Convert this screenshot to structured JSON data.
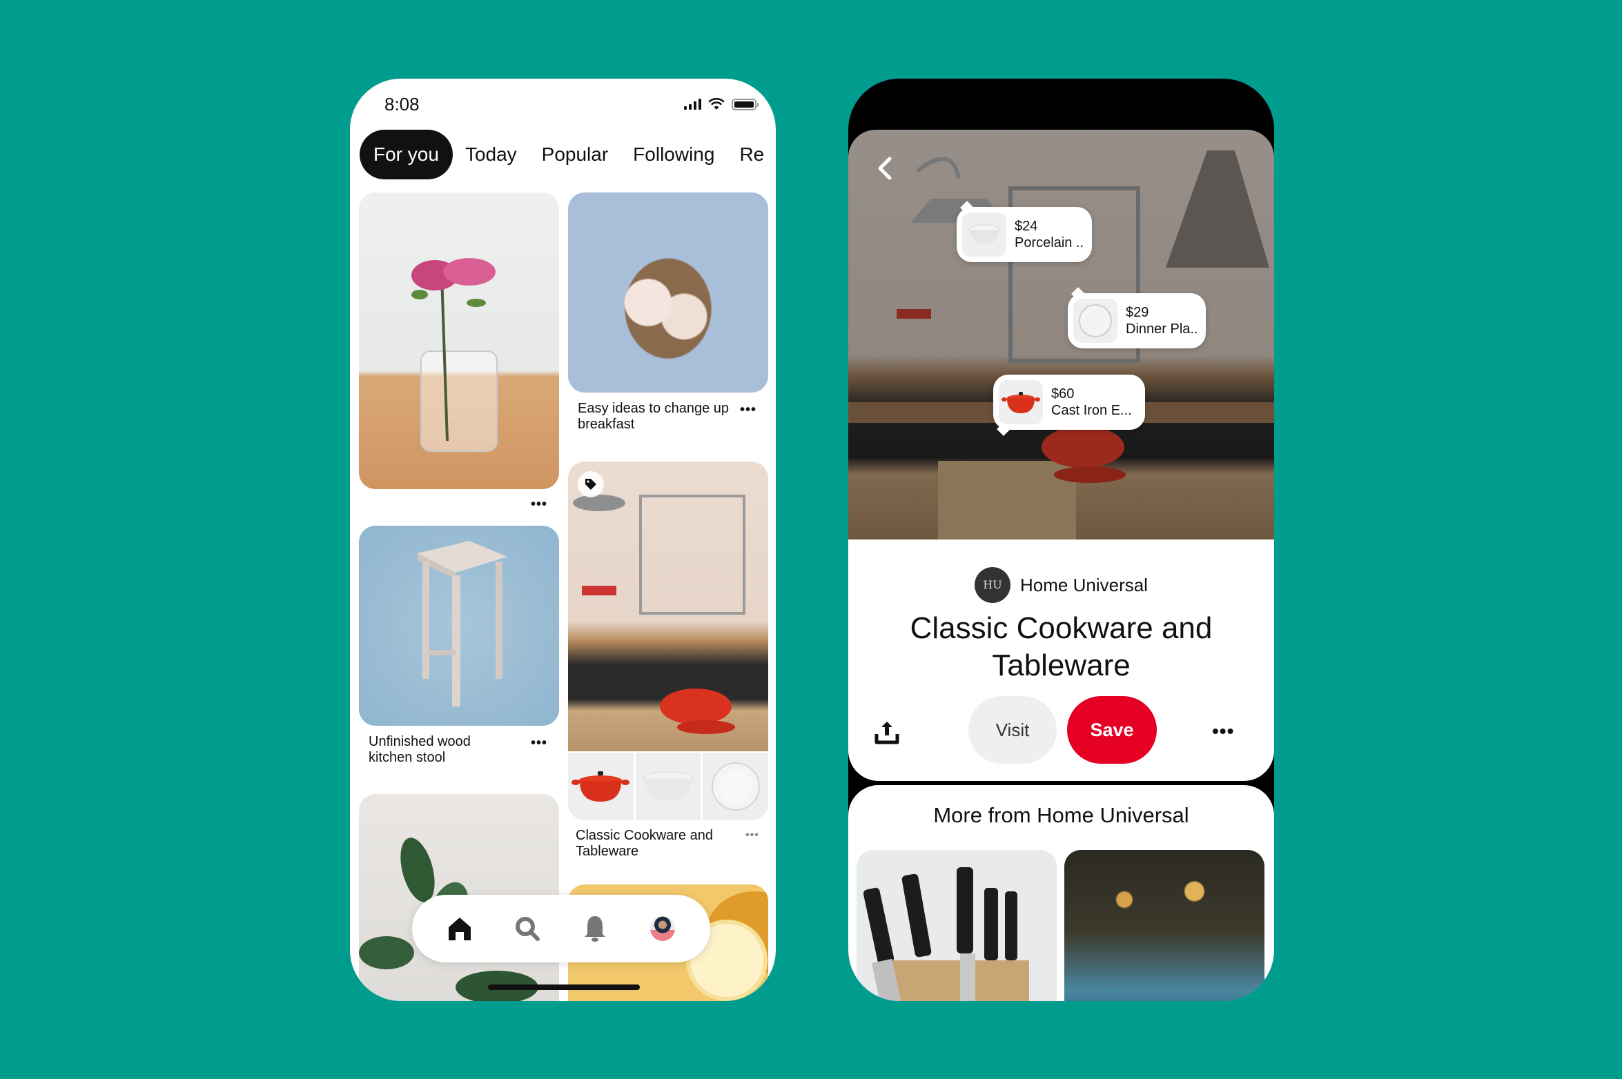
{
  "background_color": "#009c8e",
  "left_phone": {
    "status_bar": {
      "time": "8:08",
      "icons": [
        "signal-icon",
        "wifi-icon",
        "battery-icon"
      ]
    },
    "tabs": [
      {
        "label": "For you",
        "active": true
      },
      {
        "label": "Today",
        "active": false
      },
      {
        "label": "Popular",
        "active": false
      },
      {
        "label": "Following",
        "active": false
      },
      {
        "label": "Re",
        "active": false
      }
    ],
    "pins": [
      {
        "image": "flowers-in-jar",
        "title": "",
        "more_label": "•••"
      },
      {
        "image": "fig-toast",
        "title": "Easy ideas to change up breakfast",
        "more_label": "•••"
      },
      {
        "image": "wood-stool",
        "title": "Unfinished wood kitchen stool",
        "more_label": "•••"
      },
      {
        "image": "kitchen",
        "title": "Classic Cookware and Tableware",
        "more_label": "•••",
        "has_product_tag": true,
        "products": [
          "dutch-oven",
          "bowl",
          "plate"
        ]
      },
      {
        "image": "plant",
        "title": ""
      },
      {
        "image": "lemon",
        "title": ""
      }
    ],
    "bottom_nav": [
      {
        "name": "home",
        "icon": "home-icon",
        "active": true
      },
      {
        "name": "search",
        "icon": "search-icon",
        "active": false
      },
      {
        "name": "notifications",
        "icon": "bell-icon",
        "active": false
      },
      {
        "name": "profile",
        "icon": "avatar",
        "active": false
      }
    ]
  },
  "right_phone": {
    "product_tags": [
      {
        "price": "$24",
        "name": "Porcelain ..",
        "thumb": "bowl"
      },
      {
        "price": "$29",
        "name": "Dinner Pla..",
        "thumb": "plate"
      },
      {
        "price": "$60",
        "name": "Cast Iron E...",
        "thumb": "dutch-oven"
      }
    ],
    "creator": {
      "logo_text": "HU",
      "name": "Home Universal"
    },
    "title": "Classic Cookware and Tableware",
    "actions": {
      "visit_label": "Visit",
      "save_label": "Save",
      "more_label": "•••"
    },
    "colors": {
      "save_button": "#e60023",
      "visit_button": "#efefef"
    },
    "more_from": {
      "title": "More from Home Universal",
      "items": [
        {
          "image": "knife-block"
        },
        {
          "image": "candlelit-table"
        }
      ]
    }
  }
}
